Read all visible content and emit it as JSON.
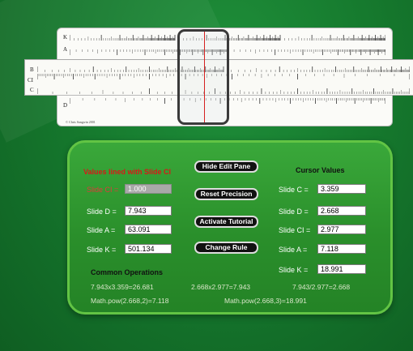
{
  "rule": {
    "labels": {
      "K": "K",
      "A": "A",
      "B": "B",
      "C": "C",
      "D": "D",
      "CI": "CI"
    },
    "copyright": "© Chris Sangwin 2001"
  },
  "panel": {
    "left_heading": "Values lined with Slide CI",
    "right_heading": "Cursor Values",
    "left_rows": [
      {
        "label": "Slide CI =",
        "value": "1.000"
      },
      {
        "label": "Slide D =",
        "value": "7.943"
      },
      {
        "label": "Slide A =",
        "value": "63.091"
      },
      {
        "label": "Slide K =",
        "value": "501.134"
      }
    ],
    "buttons": {
      "hide_edit": "Hide Edit Pane",
      "reset": "Reset Precision",
      "tutorial": "Activate Tutorial",
      "change_rule": "Change Rule"
    },
    "right_rows": [
      {
        "label": "Slide C =",
        "value": "3.359"
      },
      {
        "label": "Slide D =",
        "value": "2.668"
      },
      {
        "label": "Slide CI =",
        "value": "2.977"
      },
      {
        "label": "Slide A =",
        "value": "7.118"
      },
      {
        "label": "Slide K =",
        "value": "18.991"
      }
    ],
    "common_heading": "Common Operations",
    "equations": [
      "7.943x3.359=26.681",
      "2.668x2.977=7.943",
      "7.943/2.977=2.668",
      "Math.pow(2.668,2)=7.118",
      "Math.pow(2.668,3)=18.991"
    ]
  },
  "colors": {
    "background": "#167a2e",
    "panel": "#2f9a30",
    "heading_red": "#d81818",
    "hairline": "#d62020"
  }
}
